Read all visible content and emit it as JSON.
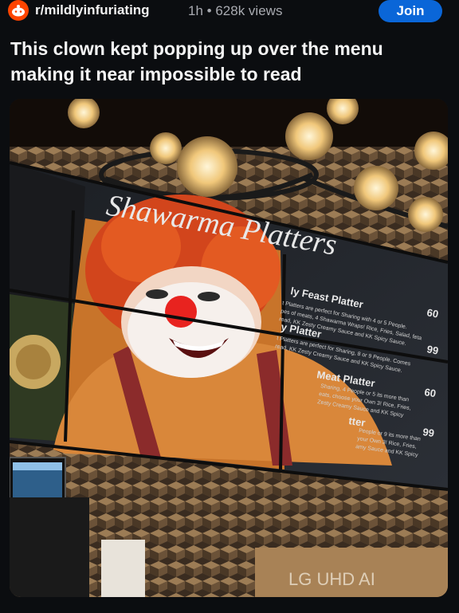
{
  "post": {
    "subreddit": "r/mildlyinfuriating",
    "age": "1h",
    "separator": "•",
    "views": "628k views",
    "join_label": "Join",
    "title": "This clown kept popping up over the menu making it near impossible to read"
  },
  "photo": {
    "menu_heading": "Shawarma Platters",
    "items": [
      {
        "name": "ly Feast Platter",
        "price": "60",
        "desc1": "t Platters are perfect for Sharing with 4 or 5 People.",
        "desc2": "pes of meats, 4 Shawarma Wraps! Rice, Fries, Salad, feta",
        "desc3": "read, KK Zesty Creamy Sauce and KK Spicy Sauce."
      },
      {
        "name": "y Platter",
        "price": "99",
        "desc1": "t Platters are perfect for Sharing, 8 or 9 People. Comes",
        "desc2": "read, KK Zesty Creamy Sauce and KK Spicy Sauce."
      },
      {
        "name": "Meat Platter",
        "price": "60",
        "desc1": "Sharing, 4 People or 5 its more than",
        "desc2": "eats, choose your Own 3! Rice, Fries,",
        "desc3": "Zesty Creamy Sauce and KK Spicy"
      },
      {
        "name": "tter",
        "price": "99",
        "desc1": "People or 9 its more than",
        "desc2": "your Own 3! Rice, Fries,",
        "desc3": "amy Sauce and KK Spicy"
      }
    ],
    "box_brand": "LG UHD AI"
  }
}
